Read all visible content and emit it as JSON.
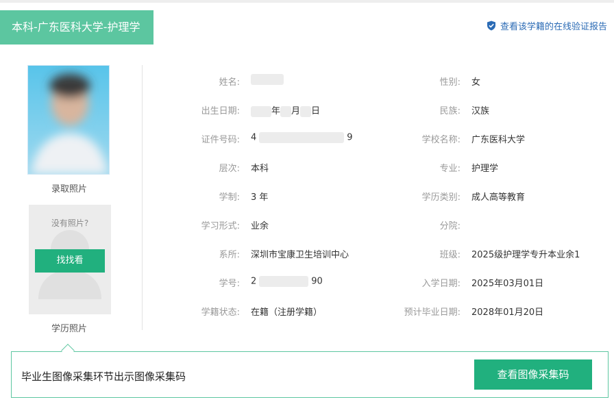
{
  "header": {
    "title": "本科-广东医科大学-护理学",
    "verify_link": "查看该学籍的在线验证报告"
  },
  "photos": {
    "admission_caption": "录取照片",
    "degree_caption": "学历照片",
    "no_photo_text": "没有照片?",
    "find_button": "找找看"
  },
  "fields": {
    "name_label": "姓名:",
    "birth_label": "出生日期:",
    "birth_year_suffix": "年",
    "birth_month_suffix": "月",
    "birth_day_suffix": "日",
    "id_label": "证件号码:",
    "id_prefix": "4",
    "id_suffix": "9",
    "level_label": "层次:",
    "level_value": "本科",
    "duration_label": "学制:",
    "duration_value": "3 年",
    "form_label": "学习形式:",
    "form_value": "业余",
    "dept_label": "系所:",
    "dept_value": "深圳市宝康卫生培训中心",
    "student_no_label": "学号:",
    "student_no_prefix": "2",
    "student_no_suffix": "90",
    "status_label": "学籍状态:",
    "status_value": "在籍（注册学籍）",
    "gender_label": "性别:",
    "gender_value": "女",
    "ethnicity_label": "民族:",
    "ethnicity_value": "汉族",
    "school_label": "学校名称:",
    "school_value": "广东医科大学",
    "major_label": "专业:",
    "major_value": "护理学",
    "edu_type_label": "学历类别:",
    "edu_type_value": "成人高等教育",
    "branch_label": "分院:",
    "branch_value": "",
    "class_label": "班级:",
    "class_value": "2025级护理学专升本业余1",
    "enroll_label": "入学日期:",
    "enroll_value": "2025年03月01日",
    "grad_label": "预计毕业日期:",
    "grad_value": "2028年01月20日"
  },
  "bottom": {
    "text": "毕业生图像采集环节出示图像采集码",
    "button": "查看图像采集码"
  },
  "colors": {
    "accent": "#5cc6a0",
    "button": "#21b07e",
    "link": "#2b6bb5"
  }
}
